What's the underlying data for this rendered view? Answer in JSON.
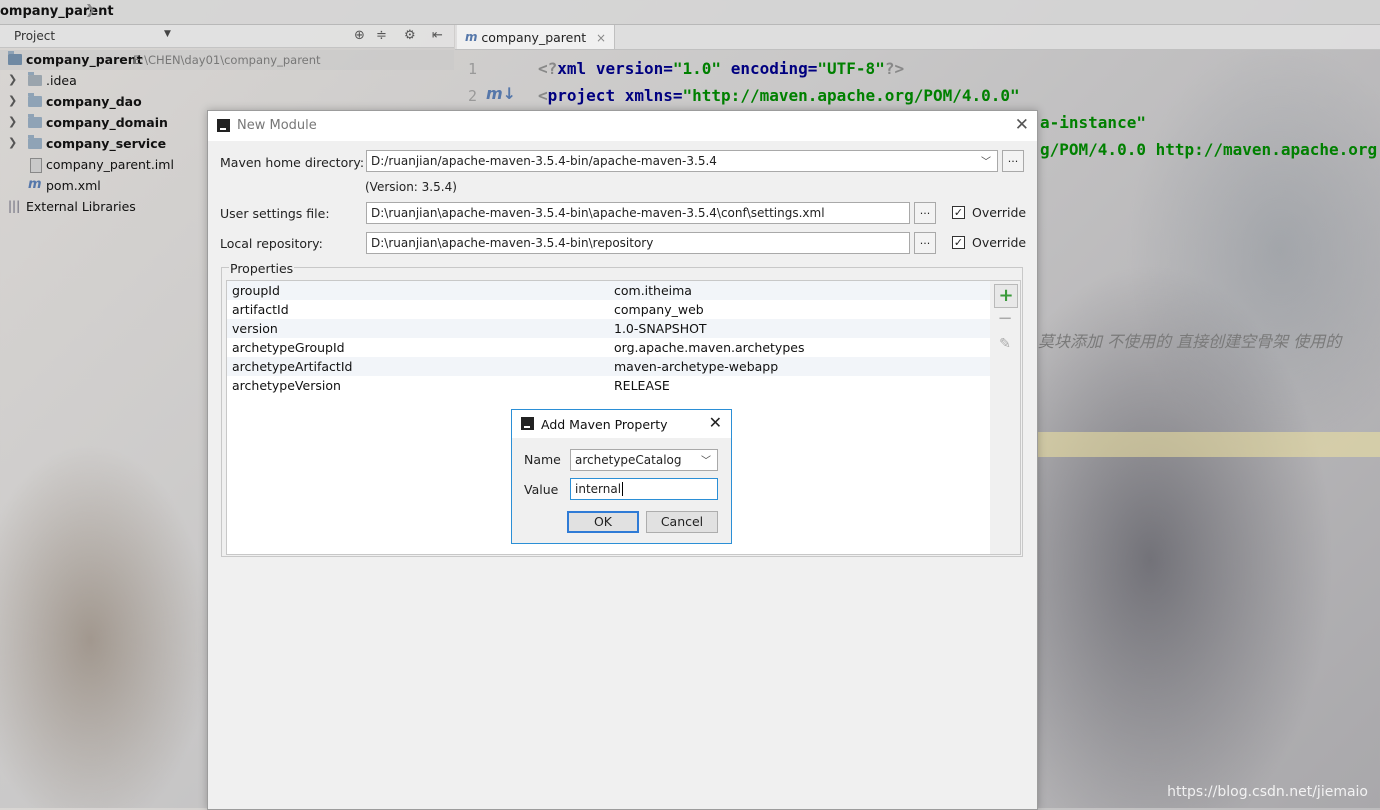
{
  "breadcrumb": {
    "text": "ompany_parent"
  },
  "project_panel": {
    "title": "Project",
    "root": {
      "name": "company_parent",
      "path": "E:\\CHEN\\day01\\company_parent"
    },
    "items": [
      {
        "label": ".idea",
        "bold": false,
        "expandable": true
      },
      {
        "label": "company_dao",
        "bold": true,
        "expandable": true
      },
      {
        "label": "company_domain",
        "bold": true,
        "expandable": true
      },
      {
        "label": "company_service",
        "bold": true,
        "expandable": true
      },
      {
        "label": "company_parent.iml",
        "bold": false,
        "expandable": false
      },
      {
        "label": "pom.xml",
        "bold": false,
        "expandable": false
      }
    ],
    "external_libraries": "External Libraries"
  },
  "editor": {
    "tab_label": "company_parent",
    "line_numbers": [
      "1",
      "2"
    ],
    "line1": {
      "pi_open": "<?",
      "xml_kw": "xml",
      "version_attr": "version=",
      "version_val": "\"1.0\"",
      "encoding_attr": "encoding=",
      "encoding_val": "\"UTF-8\"",
      "pi_close": "?>"
    },
    "line2": {
      "open": "<",
      "tag": "project",
      "attr": "xmlns=",
      "val": "\"http://maven.apache.org/POM/4.0.0\""
    },
    "line3_fragment": "a-instance\"",
    "line4_fragment": "g/POM/4.0.0 http://maven.apache.org",
    "comment_fragment": "莫块添加   不使用的 直接创建空骨架   使用的"
  },
  "new_module": {
    "title": "New Module",
    "maven_home_label": "Maven home directory:",
    "maven_home_value": "D:/ruanjian/apache-maven-3.5.4-bin/apache-maven-3.5.4",
    "version_text": "(Version: 3.5.4)",
    "user_settings_label": "User settings file:",
    "user_settings_value": "D:\\ruanjian\\apache-maven-3.5.4-bin\\apache-maven-3.5.4\\conf\\settings.xml",
    "local_repo_label": "Local repository:",
    "local_repo_value": "D:\\ruanjian\\apache-maven-3.5.4-bin\\repository",
    "override_label": "Override",
    "browse_label": "...",
    "properties_label": "Properties",
    "properties": [
      {
        "key": "groupId",
        "value": "com.itheima"
      },
      {
        "key": "artifactId",
        "value": "company_web"
      },
      {
        "key": "version",
        "value": "1.0-SNAPSHOT"
      },
      {
        "key": "archetypeGroupId",
        "value": "org.apache.maven.archetypes"
      },
      {
        "key": "archetypeArtifactId",
        "value": "maven-archetype-webapp"
      },
      {
        "key": "archetypeVersion",
        "value": "RELEASE"
      }
    ]
  },
  "add_property": {
    "title": "Add Maven Property",
    "name_label": "Name",
    "name_value": "archetypeCatalog",
    "value_label": "Value",
    "value_value": "internal",
    "ok_label": "OK",
    "cancel_label": "Cancel"
  },
  "watermark": "https://blog.csdn.net/jiemaio",
  "colors": {
    "xml_tag": "#000080",
    "xml_string": "#008000",
    "dialog_bg": "#f0f0f0",
    "focus_border": "#2b8fd6"
  },
  "icons": [
    "locate-icon",
    "collapse-icon",
    "gear-icon",
    "hide-icon",
    "maven-icon",
    "add-icon",
    "remove-icon",
    "edit-icon",
    "close-icon",
    "intellij-icon",
    "chevron-down-icon"
  ]
}
